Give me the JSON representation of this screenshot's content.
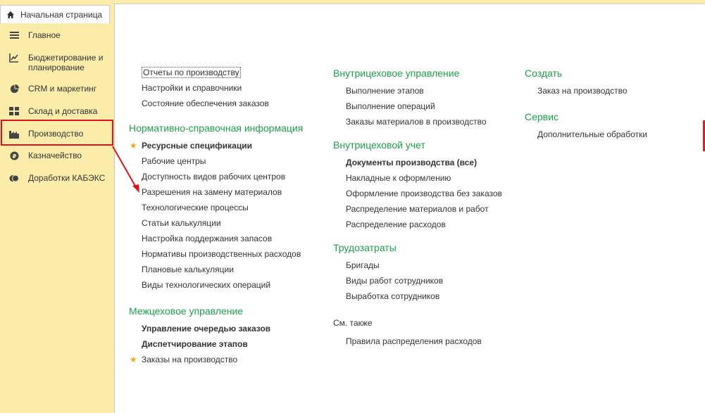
{
  "home_tab": {
    "label": "Начальная страница"
  },
  "sidebar": {
    "items": [
      {
        "label": "Главное"
      },
      {
        "label": "Бюджетирование и планирование"
      },
      {
        "label": "CRM и маркетинг"
      },
      {
        "label": "Склад и доставка"
      },
      {
        "label": "Производство"
      },
      {
        "label": "Казначейство"
      },
      {
        "label": "Доработки КАБЭКС"
      }
    ]
  },
  "col1": {
    "top_links": [
      "Отчеты по производству",
      "Настройки и справочники",
      "Состояние обеспечения заказов"
    ],
    "nsi": {
      "title": "Нормативно-справочная информация",
      "items": [
        "Ресурсные спецификации",
        "Рабочие центры",
        "Доступность видов рабочих центров",
        "Разрешения на замену материалов",
        "Технологические процессы",
        "Статьи калькуляции",
        "Настройка поддержания запасов",
        "Нормативы производственных расходов",
        "Плановые калькуляции",
        "Виды технологических операций"
      ]
    },
    "inter": {
      "title": "Межцеховое управление",
      "items": [
        "Управление очередью заказов",
        "Диспетчирование этапов",
        "Заказы на производство"
      ]
    }
  },
  "col2": {
    "intra_mgmt": {
      "title": "Внутрицеховое управление",
      "items": [
        "Выполнение этапов",
        "Выполнение операций",
        "Заказы материалов в производство"
      ]
    },
    "intra_acc": {
      "title": "Внутрицеховой учет",
      "items": [
        "Документы производства (все)",
        "Накладные к оформлению",
        "Оформление производства без заказов",
        "Распределение материалов и работ",
        "Распределение расходов"
      ]
    },
    "labor": {
      "title": "Трудозатраты",
      "items": [
        "Бригады",
        "Виды работ сотрудников",
        "Выработка сотрудников"
      ]
    },
    "see_also": {
      "title": "См. также",
      "items": [
        "Правила распределения расходов"
      ]
    }
  },
  "col3": {
    "create": {
      "title": "Создать",
      "items": [
        "Заказ на производство"
      ]
    },
    "service": {
      "title": "Сервис",
      "items": [
        "Дополнительные обработки"
      ]
    }
  },
  "colors": {
    "section_title": "#1e9f4a",
    "sidebar_bg": "#fbeca9",
    "highlight": "#e3101d",
    "star": "#f5a623"
  }
}
